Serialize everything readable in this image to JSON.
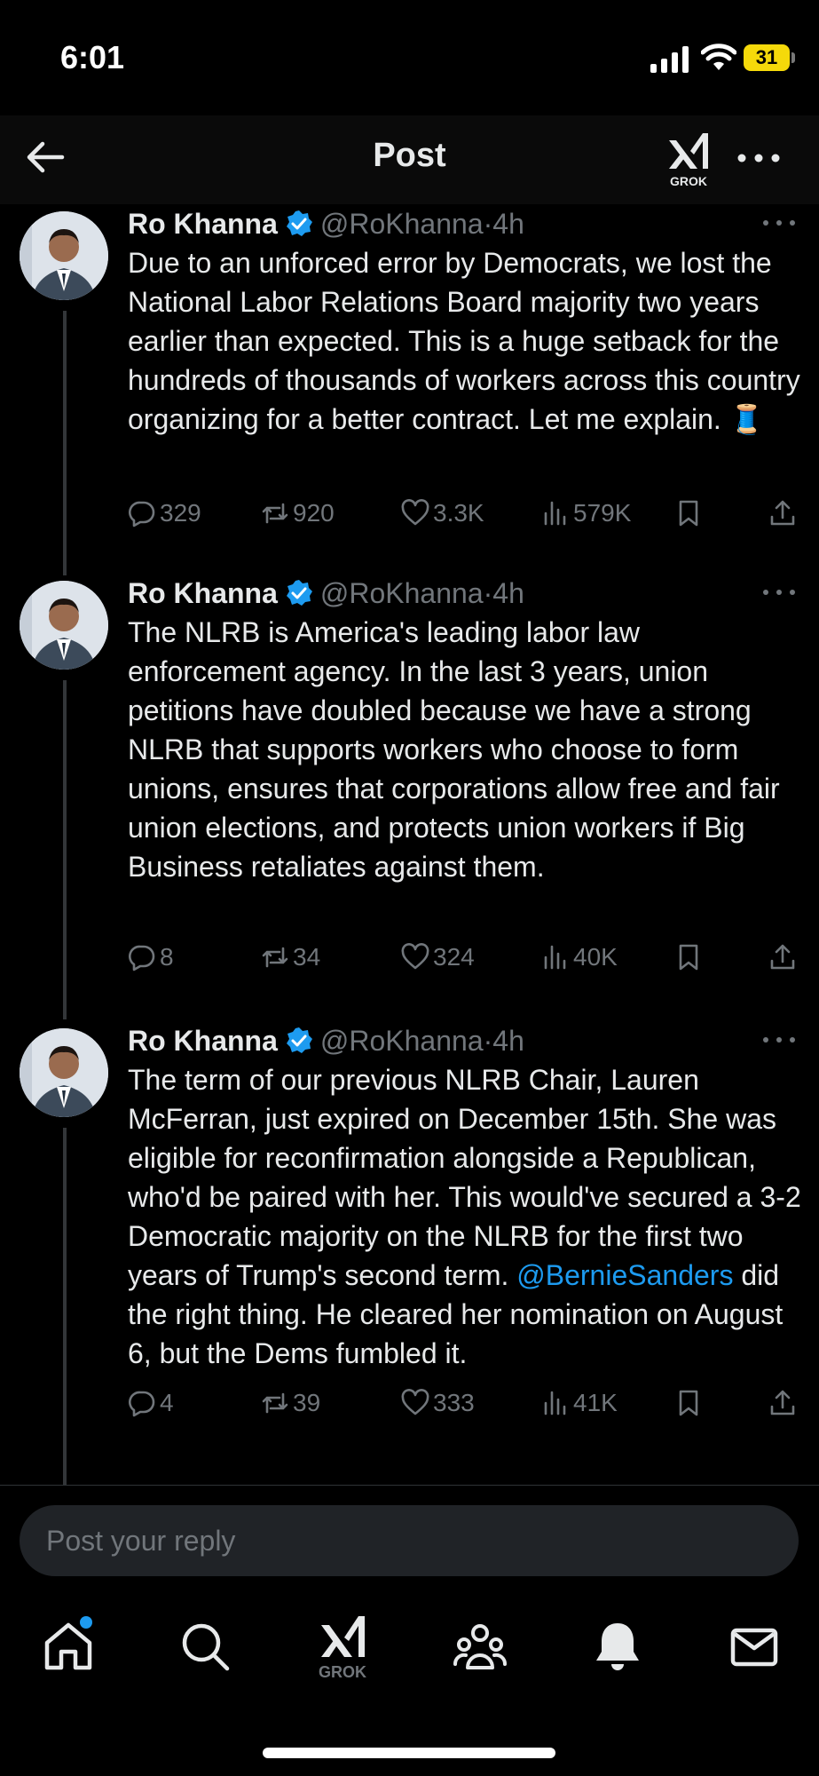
{
  "status_bar": {
    "time": "6:01",
    "battery": "31"
  },
  "header": {
    "title": "Post",
    "grok_label": "GROK"
  },
  "posts": [
    {
      "name": "Ro Khanna",
      "handle": "@RoKhanna",
      "sep": " · ",
      "age": "4h",
      "text": "Due to an unforced error by Democrats, we lost the National Labor Relations Board majority two years earlier than expected. This is a huge setback for the hundreds of thousands of workers across this country organizing for a better contract. Let me explain. 🧵",
      "replies": "329",
      "reposts": "920",
      "likes": "3.3K",
      "views": "579K"
    },
    {
      "name": "Ro Khanna",
      "handle": "@RoKhanna",
      "sep": " · ",
      "age": "4h",
      "text": "The NLRB is America's leading labor law enforcement agency. In the last 3 years, union petitions have doubled because we have a strong NLRB that supports workers who choose to form unions, ensures that corporations allow free and fair union elections, and protects union workers if Big Business retaliates against them.",
      "replies": "8",
      "reposts": "34",
      "likes": "324",
      "views": "40K"
    },
    {
      "name": "Ro Khanna",
      "handle": "@RoKhanna",
      "sep": " · ",
      "age": "4h",
      "text_before": "The term of our previous NLRB Chair, Lauren McFerran, just expired on December 15th. She was eligible for reconfirmation alongside a Republican, who'd be paired with her. This would've secured a 3-2 Democratic majority on the NLRB for the first two years of Trump's second term. ",
      "mention": "@BernieSanders",
      "text_after": " did the right thing. He cleared her nomination on August 6, but the Dems fumbled it.",
      "replies": "4",
      "reposts": "39",
      "likes": "333",
      "views": "41K"
    }
  ],
  "reply": {
    "placeholder": "Post your reply"
  },
  "tabbar": {
    "grok_label": "GROK"
  },
  "colors": {
    "accent": "#1d9bf0",
    "muted": "#71767b",
    "background": "#000000",
    "text": "#e7e9ea"
  }
}
